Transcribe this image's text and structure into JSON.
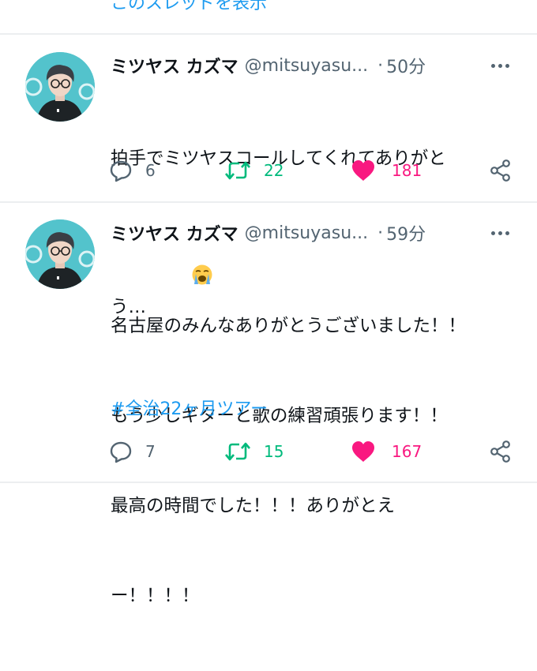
{
  "thread_link": "このスレッドを表示",
  "tweets": [
    {
      "name": "ミツヤス カズマ",
      "handle": "@mitsuyasu...",
      "separator": "·",
      "time": "50分",
      "text_lines": [
        "拍手でミツヤスコールしてくれてありがと",
        "う…"
      ],
      "emoji": "loudly-crying-face",
      "hashtag": "",
      "replies": "6",
      "retweets": "22",
      "likes": "181",
      "liked": true
    },
    {
      "name": "ミツヤス カズマ",
      "handle": "@mitsuyasu...",
      "separator": "·",
      "time": "59分",
      "text_lines": [
        "名古屋のみんなありがとうございました！！",
        "もう少しギターと歌の練習頑張ります！！",
        "最高の時間でした！！！ありがとえ",
        "ー！！！！"
      ],
      "emoji": "",
      "hashtag": "#全治22ヶ月ツアー",
      "replies": "7",
      "retweets": "15",
      "likes": "167",
      "liked": true
    }
  ],
  "colors": {
    "link": "#1d9bf0",
    "retweet": "#00ba7c",
    "like": "#f91880",
    "muted": "#536471",
    "avatar_bg": "#53c3cc"
  }
}
